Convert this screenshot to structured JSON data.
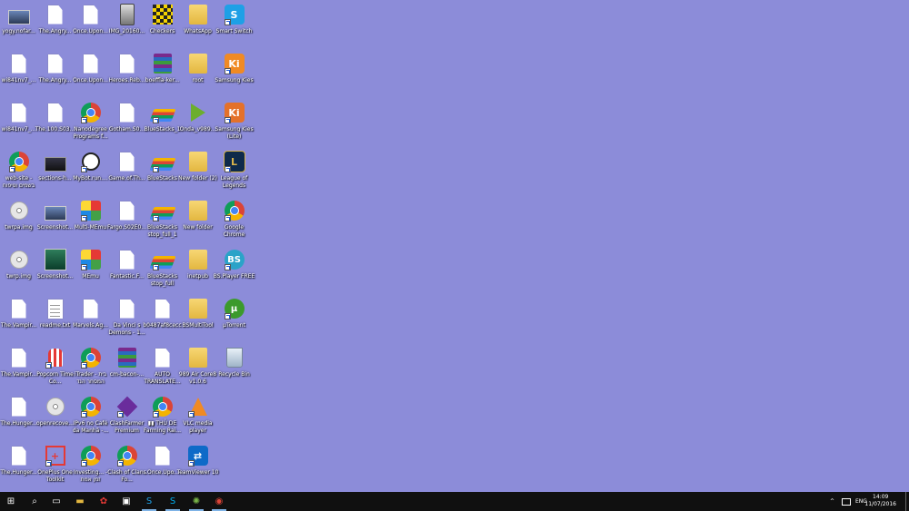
{
  "desktop": {
    "icons": [
      {
        "label": "yogy.nofar...",
        "icon": "photo-icon",
        "shortcut": false
      },
      {
        "label": "The.Angry...",
        "icon": "file-icon",
        "shortcut": false
      },
      {
        "label": "Once.Upon...",
        "icon": "file-icon",
        "shortcut": false
      },
      {
        "label": "IMG_20160...",
        "icon": "phone-image-icon",
        "shortcut": false
      },
      {
        "label": "Checkers",
        "icon": "checkers-icon",
        "shortcut": false
      },
      {
        "label": "WhatsApp",
        "icon": "folder-icon",
        "shortcut": false
      },
      {
        "label": "Smart Switch",
        "icon": "smart-switch-icon",
        "shortcut": true
      },
      {
        "label": "wi841nv7_...",
        "icon": "file-icon",
        "shortcut": false
      },
      {
        "label": "The.Angry...",
        "icon": "file-icon",
        "shortcut": false
      },
      {
        "label": "Once.Upon...",
        "icon": "file-icon",
        "shortcut": false
      },
      {
        "label": "Heroes.Reb...",
        "icon": "file-icon",
        "shortcut": false
      },
      {
        "label": "boeffla-ker...",
        "icon": "archive-icon",
        "shortcut": false
      },
      {
        "label": "root",
        "icon": "folder-icon",
        "shortcut": false
      },
      {
        "label": "Samsung Kies",
        "icon": "kies-icon",
        "shortcut": true
      },
      {
        "label": "wi841nv7_...",
        "icon": "file-icon",
        "shortcut": false
      },
      {
        "label": "The.100.S03...",
        "icon": "file-icon",
        "shortcut": false
      },
      {
        "label": "Nanodegree Programs f...",
        "icon": "chrome-icon",
        "shortcut": true
      },
      {
        "label": "Gotham.S0...",
        "icon": "file-icon",
        "shortcut": false
      },
      {
        "label": "BlueStacks_1",
        "icon": "bluestacks-icon",
        "shortcut": true
      },
      {
        "label": "Onda_v989...",
        "icon": "play-folder-icon",
        "shortcut": false
      },
      {
        "label": "Samsung Kies (Lite)",
        "icon": "kies-lite-icon",
        "shortcut": true
      },
      {
        "label": "web-site - בשמים וטיפוח",
        "icon": "chrome-icon",
        "shortcut": true
      },
      {
        "label": "sections-h...",
        "icon": "dark-image-icon",
        "shortcut": false
      },
      {
        "label": "MyBot.run....",
        "icon": "mybot-icon",
        "shortcut": true
      },
      {
        "label": "Game.of.Th...",
        "icon": "file-icon",
        "shortcut": false
      },
      {
        "label": "BlueStacks",
        "icon": "bluestacks-icon",
        "shortcut": true
      },
      {
        "label": "New folder (2)",
        "icon": "folder-icon",
        "shortcut": false
      },
      {
        "label": "League of Legends",
        "icon": "lol-icon",
        "shortcut": true
      },
      {
        "label": "twrpa.img",
        "icon": "disc-image-icon",
        "shortcut": false
      },
      {
        "label": "Screenshot...",
        "icon": "photo-icon",
        "shortcut": false
      },
      {
        "label": "Multi-MEmu",
        "icon": "memu-icon",
        "shortcut": true
      },
      {
        "label": "Fargo.S02E0...",
        "icon": "file-icon",
        "shortcut": false
      },
      {
        "label": "BlueStacks stop_full_1",
        "icon": "bluestacks-icon",
        "shortcut": true
      },
      {
        "label": "New folder",
        "icon": "folder-icon",
        "shortcut": false
      },
      {
        "label": "Google Chrome",
        "icon": "chrome-icon",
        "shortcut": true
      },
      {
        "label": "twrp.img",
        "icon": "disc-image-icon",
        "shortcut": false
      },
      {
        "label": "Screenshot...",
        "icon": "green-image-icon",
        "shortcut": false
      },
      {
        "label": "MEmu",
        "icon": "memu-icon",
        "shortcut": true
      },
      {
        "label": "Fantastic.F...",
        "icon": "file-icon",
        "shortcut": false
      },
      {
        "label": "BlueStacks stop_full",
        "icon": "bluestacks-icon",
        "shortcut": true
      },
      {
        "label": "inetpub",
        "icon": "folder-icon",
        "shortcut": false
      },
      {
        "label": "BS.Player FREE",
        "icon": "bsplayer-icon",
        "shortcut": true
      },
      {
        "label": "The.Vampir...",
        "icon": "file-icon",
        "shortcut": false
      },
      {
        "label": "readme.txt",
        "icon": "text-file-icon",
        "shortcut": false
      },
      {
        "label": "Marvels.Ag...",
        "icon": "file-icon",
        "shortcut": false
      },
      {
        "label": "Da Vinci s Demons - 1...",
        "icon": "file-icon",
        "shortcut": false
      },
      {
        "label": "b0487af8cecc",
        "icon": "file-icon",
        "shortcut": false
      },
      {
        "label": "BSMultiTool",
        "icon": "folder-icon",
        "shortcut": false
      },
      {
        "label": "µTorrent",
        "icon": "utorrent-icon",
        "shortcut": true
      },
      {
        "label": "The.Vampir...",
        "icon": "file-icon",
        "shortcut": false
      },
      {
        "label": "Popcorn Time Co...",
        "icon": "popcorn-icon",
        "shortcut": true
      },
      {
        "label": "iTrader - בית המסחר הנד",
        "icon": "chrome-icon",
        "shortcut": true
      },
      {
        "label": "cm-bacon-...",
        "icon": "archive-icon",
        "shortcut": false
      },
      {
        "label": "AUTO TRANSLATE...",
        "icon": "file-icon",
        "shortcut": false
      },
      {
        "label": "989 Air Core8 v1.0.6",
        "icon": "folder-icon",
        "shortcut": false
      },
      {
        "label": "Recycle Bin",
        "icon": "recycle-bin-icon",
        "shortcut": false
      },
      {
        "label": "The.Hunger...",
        "icon": "file-icon",
        "shortcut": false
      },
      {
        "label": "openrecove...",
        "icon": "disc-image-icon",
        "shortcut": false
      },
      {
        "label": "IPv6 no Café da Manhã -...",
        "icon": "chrome-icon",
        "shortcut": true
      },
      {
        "label": "ClashFarmer Premium",
        "icon": "clashfarmer-icon",
        "shortcut": true
      },
      {
        "label": "▮▮ THỦ DE Farming Rai...",
        "icon": "chrome-icon",
        "shortcut": true
      },
      {
        "label": "VLC media player",
        "icon": "vlc-icon",
        "shortcut": true
      },
      {
        "label": "The.Hunger...",
        "icon": "file-icon",
        "shortcut": false
      },
      {
        "label": "OnePlus One Toolkit",
        "icon": "oneplus-icon",
        "shortcut": true
      },
      {
        "label": "Investing... - זמן אמת",
        "icon": "chrome-icon",
        "shortcut": true
      },
      {
        "label": "Clash of Clans Fo...",
        "icon": "chrome-icon",
        "shortcut": true
      },
      {
        "label": ".Once.Upo...",
        "icon": "file-icon",
        "shortcut": false
      },
      {
        "label": "TeamViewer 10",
        "icon": "teamviewer-icon",
        "shortcut": true
      }
    ]
  },
  "taskbar": {
    "pinned": [
      {
        "name": "start-button",
        "icon": "windows-icon"
      },
      {
        "name": "search-button",
        "icon": "search-icon"
      },
      {
        "name": "task-view-button",
        "icon": "task-view-icon"
      },
      {
        "name": "file-explorer-button",
        "icon": "folder-icon"
      },
      {
        "name": "memu-taskbar-button",
        "icon": "memu-icon"
      },
      {
        "name": "store-button",
        "icon": "store-icon"
      },
      {
        "name": "smart-switch-taskbar-button",
        "icon": "smart-switch-icon"
      },
      {
        "name": "skype-taskbar-button",
        "icon": "skype-icon"
      },
      {
        "name": "app-taskbar-button",
        "icon": "app-icon"
      },
      {
        "name": "chrome-taskbar-button",
        "icon": "chrome-icon"
      }
    ],
    "tray": {
      "chevron": "^",
      "language": "ENG",
      "time": "14:09",
      "date": "11/07/2016"
    }
  }
}
